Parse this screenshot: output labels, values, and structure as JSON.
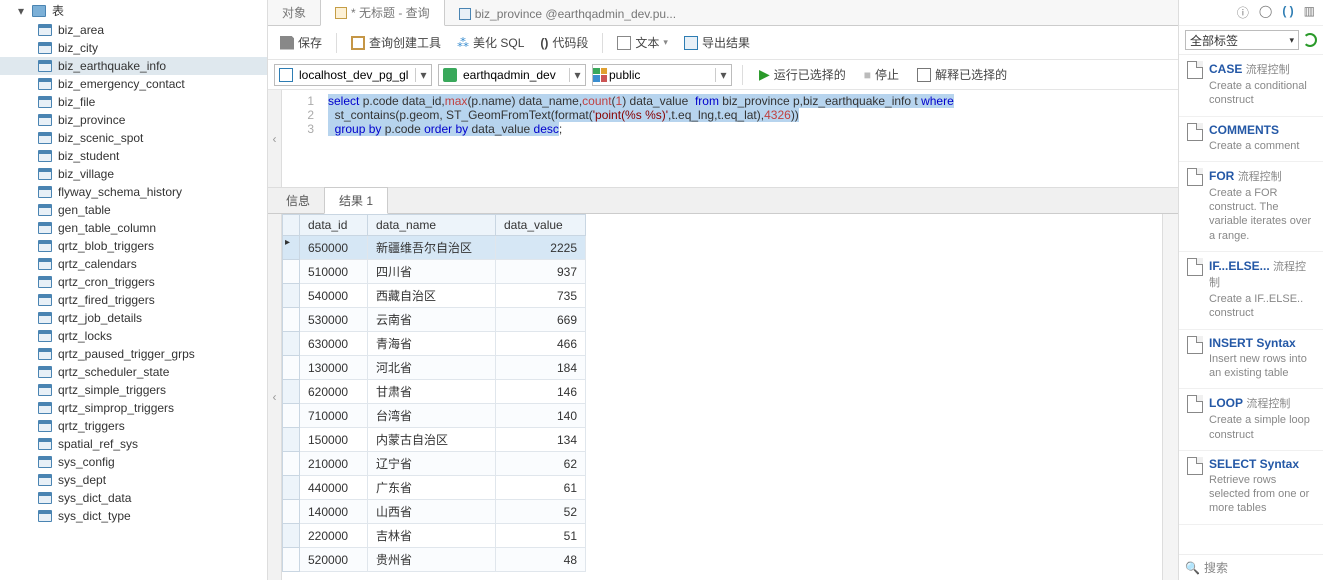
{
  "sidebar": {
    "root_label": "表",
    "items": [
      "biz_area",
      "biz_city",
      "biz_earthquake_info",
      "biz_emergency_contact",
      "biz_file",
      "biz_province",
      "biz_scenic_spot",
      "biz_student",
      "biz_village",
      "flyway_schema_history",
      "gen_table",
      "gen_table_column",
      "qrtz_blob_triggers",
      "qrtz_calendars",
      "qrtz_cron_triggers",
      "qrtz_fired_triggers",
      "qrtz_job_details",
      "qrtz_locks",
      "qrtz_paused_trigger_grps",
      "qrtz_scheduler_state",
      "qrtz_simple_triggers",
      "qrtz_simprop_triggers",
      "qrtz_triggers",
      "spatial_ref_sys",
      "sys_config",
      "sys_dept",
      "sys_dict_data",
      "sys_dict_type"
    ],
    "selected_index": 2
  },
  "tabs": {
    "t0": "对象",
    "t1": "* 无标题 - 查询",
    "t2": "biz_province @earthqadmin_dev.pu..."
  },
  "toolbar": {
    "save": "保存",
    "builder": "查询创建工具",
    "beautify": "美化 SQL",
    "snippet": "代码段",
    "text": "文本",
    "export": "导出结果"
  },
  "conn": {
    "connection": "localhost_dev_pg_gl",
    "database": "earthqadmin_dev",
    "schema": "public",
    "run": "运行已选择的",
    "stop": "停止",
    "explain": "解释已选择的"
  },
  "editor": {
    "lines": [
      "1",
      "2",
      "3"
    ],
    "l1a": "select",
    "l1b": " p.code data_id,",
    "l1c": "max",
    "l1d": "(p.name) data_name,",
    "l1e": "count",
    "l1f": "(",
    "l1g": "1",
    "l1h": ") data_value  ",
    "l1i": "from",
    "l1j": " biz_province p,biz_earthquake_info t ",
    "l1k": "where",
    "l2a": "  st_contains(p.geom, ST_GeomFromText(format(",
    "l2b": "'point(%s %s)'",
    "l2c": ",t.eq_lng,t.eq_lat),",
    "l2d": "4326",
    "l2e": "))",
    "l3a": "  ",
    "l3b": "group",
    "l3c": " ",
    "l3d": "by",
    "l3e": " p.code ",
    "l3f": "order",
    "l3g": " ",
    "l3h": "by",
    "l3i": " data_value ",
    "l3j": "desc",
    "l3k": ";"
  },
  "subtabs": {
    "info": "信息",
    "result": "结果 1"
  },
  "columns": {
    "c0": "data_id",
    "c1": "data_name",
    "c2": "data_value"
  },
  "rows": [
    {
      "id": "650000",
      "name": "新疆维吾尔自治区",
      "val": "2225"
    },
    {
      "id": "510000",
      "name": "四川省",
      "val": "937"
    },
    {
      "id": "540000",
      "name": "西藏自治区",
      "val": "735"
    },
    {
      "id": "530000",
      "name": "云南省",
      "val": "669"
    },
    {
      "id": "630000",
      "name": "青海省",
      "val": "466"
    },
    {
      "id": "130000",
      "name": "河北省",
      "val": "184"
    },
    {
      "id": "620000",
      "name": "甘肃省",
      "val": "146"
    },
    {
      "id": "710000",
      "name": "台湾省",
      "val": "140"
    },
    {
      "id": "150000",
      "name": "内蒙古自治区",
      "val": "134"
    },
    {
      "id": "210000",
      "name": "辽宁省",
      "val": "62"
    },
    {
      "id": "440000",
      "name": "广东省",
      "val": "61"
    },
    {
      "id": "140000",
      "name": "山西省",
      "val": "52"
    },
    {
      "id": "220000",
      "name": "吉林省",
      "val": "51"
    },
    {
      "id": "520000",
      "name": "贵州省",
      "val": "48"
    }
  ],
  "right": {
    "all_tags": "全部标签",
    "search": "搜索",
    "tag": "流程控制",
    "items": [
      {
        "name": "CASE",
        "desc": "Create a conditional construct",
        "tag": "流程控制"
      },
      {
        "name": "COMMENTS",
        "desc": "Create a comment",
        "tag": ""
      },
      {
        "name": "FOR",
        "desc": "Create a FOR construct. The variable iterates over a range.",
        "tag": "流程控制"
      },
      {
        "name": "IF...ELSE...",
        "desc": "Create a IF..ELSE.. construct",
        "tag": "流程控制"
      },
      {
        "name": "INSERT Syntax",
        "desc": "Insert new rows into an existing table",
        "tag": ""
      },
      {
        "name": "LOOP",
        "desc": "Create a simple loop construct",
        "tag": "流程控制"
      },
      {
        "name": "SELECT Syntax",
        "desc": "Retrieve rows selected from one or more tables",
        "tag": ""
      }
    ]
  }
}
